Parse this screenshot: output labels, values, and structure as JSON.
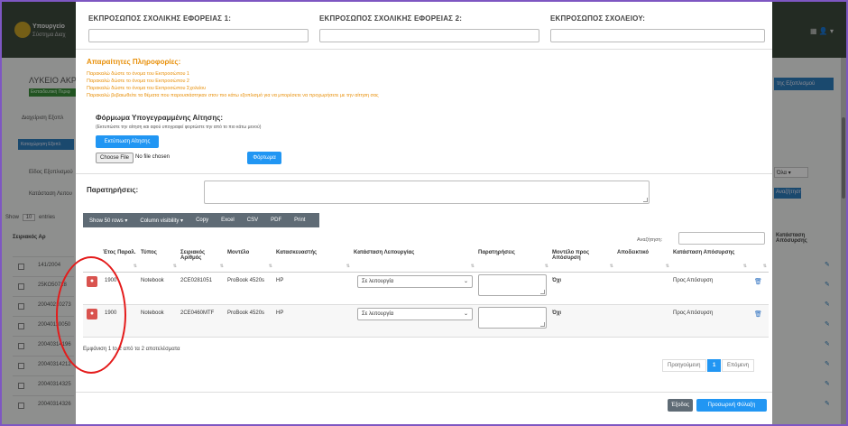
{
  "background": {
    "brand": "Υπουργείο",
    "brand_sub": "Σύστημα Διαχ",
    "school_title": "ΛΥΚΕΙΟ ΑΚΡ",
    "badge": "Εκπαιδευτική Περιφ",
    "tab_label": "Διαχείριση Εξοπλ",
    "blue_btn": "Καταχώρηση Εξοπλ",
    "label_type": "Είδος Εξοπλισμού",
    "label_status": "Κατάσταση Λειτου",
    "show_label": "Show",
    "show_value": "10",
    "show_entries": "entries",
    "right_button": "της Εξοπλισμού",
    "right_select": "Όλα",
    "right_search": "Αναζήτηση",
    "head_left": "Σειριακός Αρ",
    "head_right": "Κατάσταση Απόσυρσης",
    "rows": [
      "141/2004",
      "25ΚΟ50718",
      "20040210273",
      "20040110050",
      "20040314196",
      "20040314212",
      "20040314325",
      "20040314326"
    ],
    "top_right": "▦  👤 ▾"
  },
  "modal": {
    "header_labels": [
      "ΕΚΠΡΟΣΩΠΟΣ ΣΧΟΛΙΚΗΣ ΕΦΟΡΕΙΑΣ 1:",
      "ΕΚΠΡΟΣΩΠΟΣ ΣΧΟΛΙΚΗΣ ΕΦΟΡΕΙΑΣ 2:",
      "ΕΚΠΡΟΣΩΠΟΣ ΣΧΟΛΕΙΟΥ:"
    ],
    "warnings_title": "Απαραίτητες Πληροφορίες:",
    "warnings": [
      "Παρακαλώ δώστε το όνομα του Εκπροσώπου 1",
      "Παρακαλώ δώστε το όνομα του Εκπροσώπου 2",
      "Παρακαλώ δώστε το όνομα του Εκπροσώπου Σχολείου",
      "Παρακαλώ βεβαιωθείτε τα θέματα που παρουσιάστηκαν στον πιο κάτω εξοπλισμό για να μπορέσετε να προχωρήσετε με την αίτηση σας"
    ],
    "form_title": "Φόρμωμα Υπογεγραμμένης Αίτησης:",
    "form_sub": "(Εκτυπώστε την αίτηση και αφού υπογραφεί φορτώστε την από το πιο κάτω μενού)",
    "print_button": "Εκτύπωση Αίτησης",
    "choose_file": "Choose File",
    "no_file": "No file chosen",
    "upload_button": "Φόρτωμα",
    "notes_label": "Παρατηρήσεις:",
    "toolbar": [
      "Show 50 rows ▾",
      "Column visibility ▾",
      "Copy",
      "Excel",
      "CSV",
      "PDF",
      "Print"
    ],
    "search_label": "Αναζήτηση:",
    "columns": [
      "",
      "Έτος Παραλ.",
      "Τύπος",
      "Σειριακός Αριθμός",
      "Μοντέλο",
      "Κατασκευαστής",
      "Κατάσταση Λειτουργίας",
      "Παρατηρήσεις",
      "Μοντέλο προς Απόσυρση",
      "Αποδεικτικό",
      "Κατάσταση Απόσυρσης",
      ""
    ],
    "rows": [
      {
        "year": "1900",
        "type": "Notebook",
        "serial": "2CE0281051",
        "model": "ProBook 4520s",
        "maker": "HP",
        "status": "Σε λειτουργία",
        "withdraw": "Όχι",
        "withdraw_status": "Προς Απόσυρση"
      },
      {
        "year": "1900",
        "type": "Notebook",
        "serial": "2CE0460MTF",
        "model": "ProBook 4520s",
        "maker": "HP",
        "status": "Σε λειτουργία",
        "withdraw": "Όχι",
        "withdraw_status": "Προς Απόσυρση"
      }
    ],
    "showing": "Εμφάνιση 1 to 2 από τα 2 αποτελέσματα",
    "pagination": {
      "prev": "Προηγούμενη",
      "current": "1",
      "next": "Επόμενη"
    },
    "exit_button": "Έξοδος",
    "save_button": "Προσωρινή Φύλαξη"
  },
  "colors": {
    "accent": "#2196f3",
    "danger": "#d9534f",
    "warning": "#e8900a",
    "annotation": "#e41b1b"
  }
}
